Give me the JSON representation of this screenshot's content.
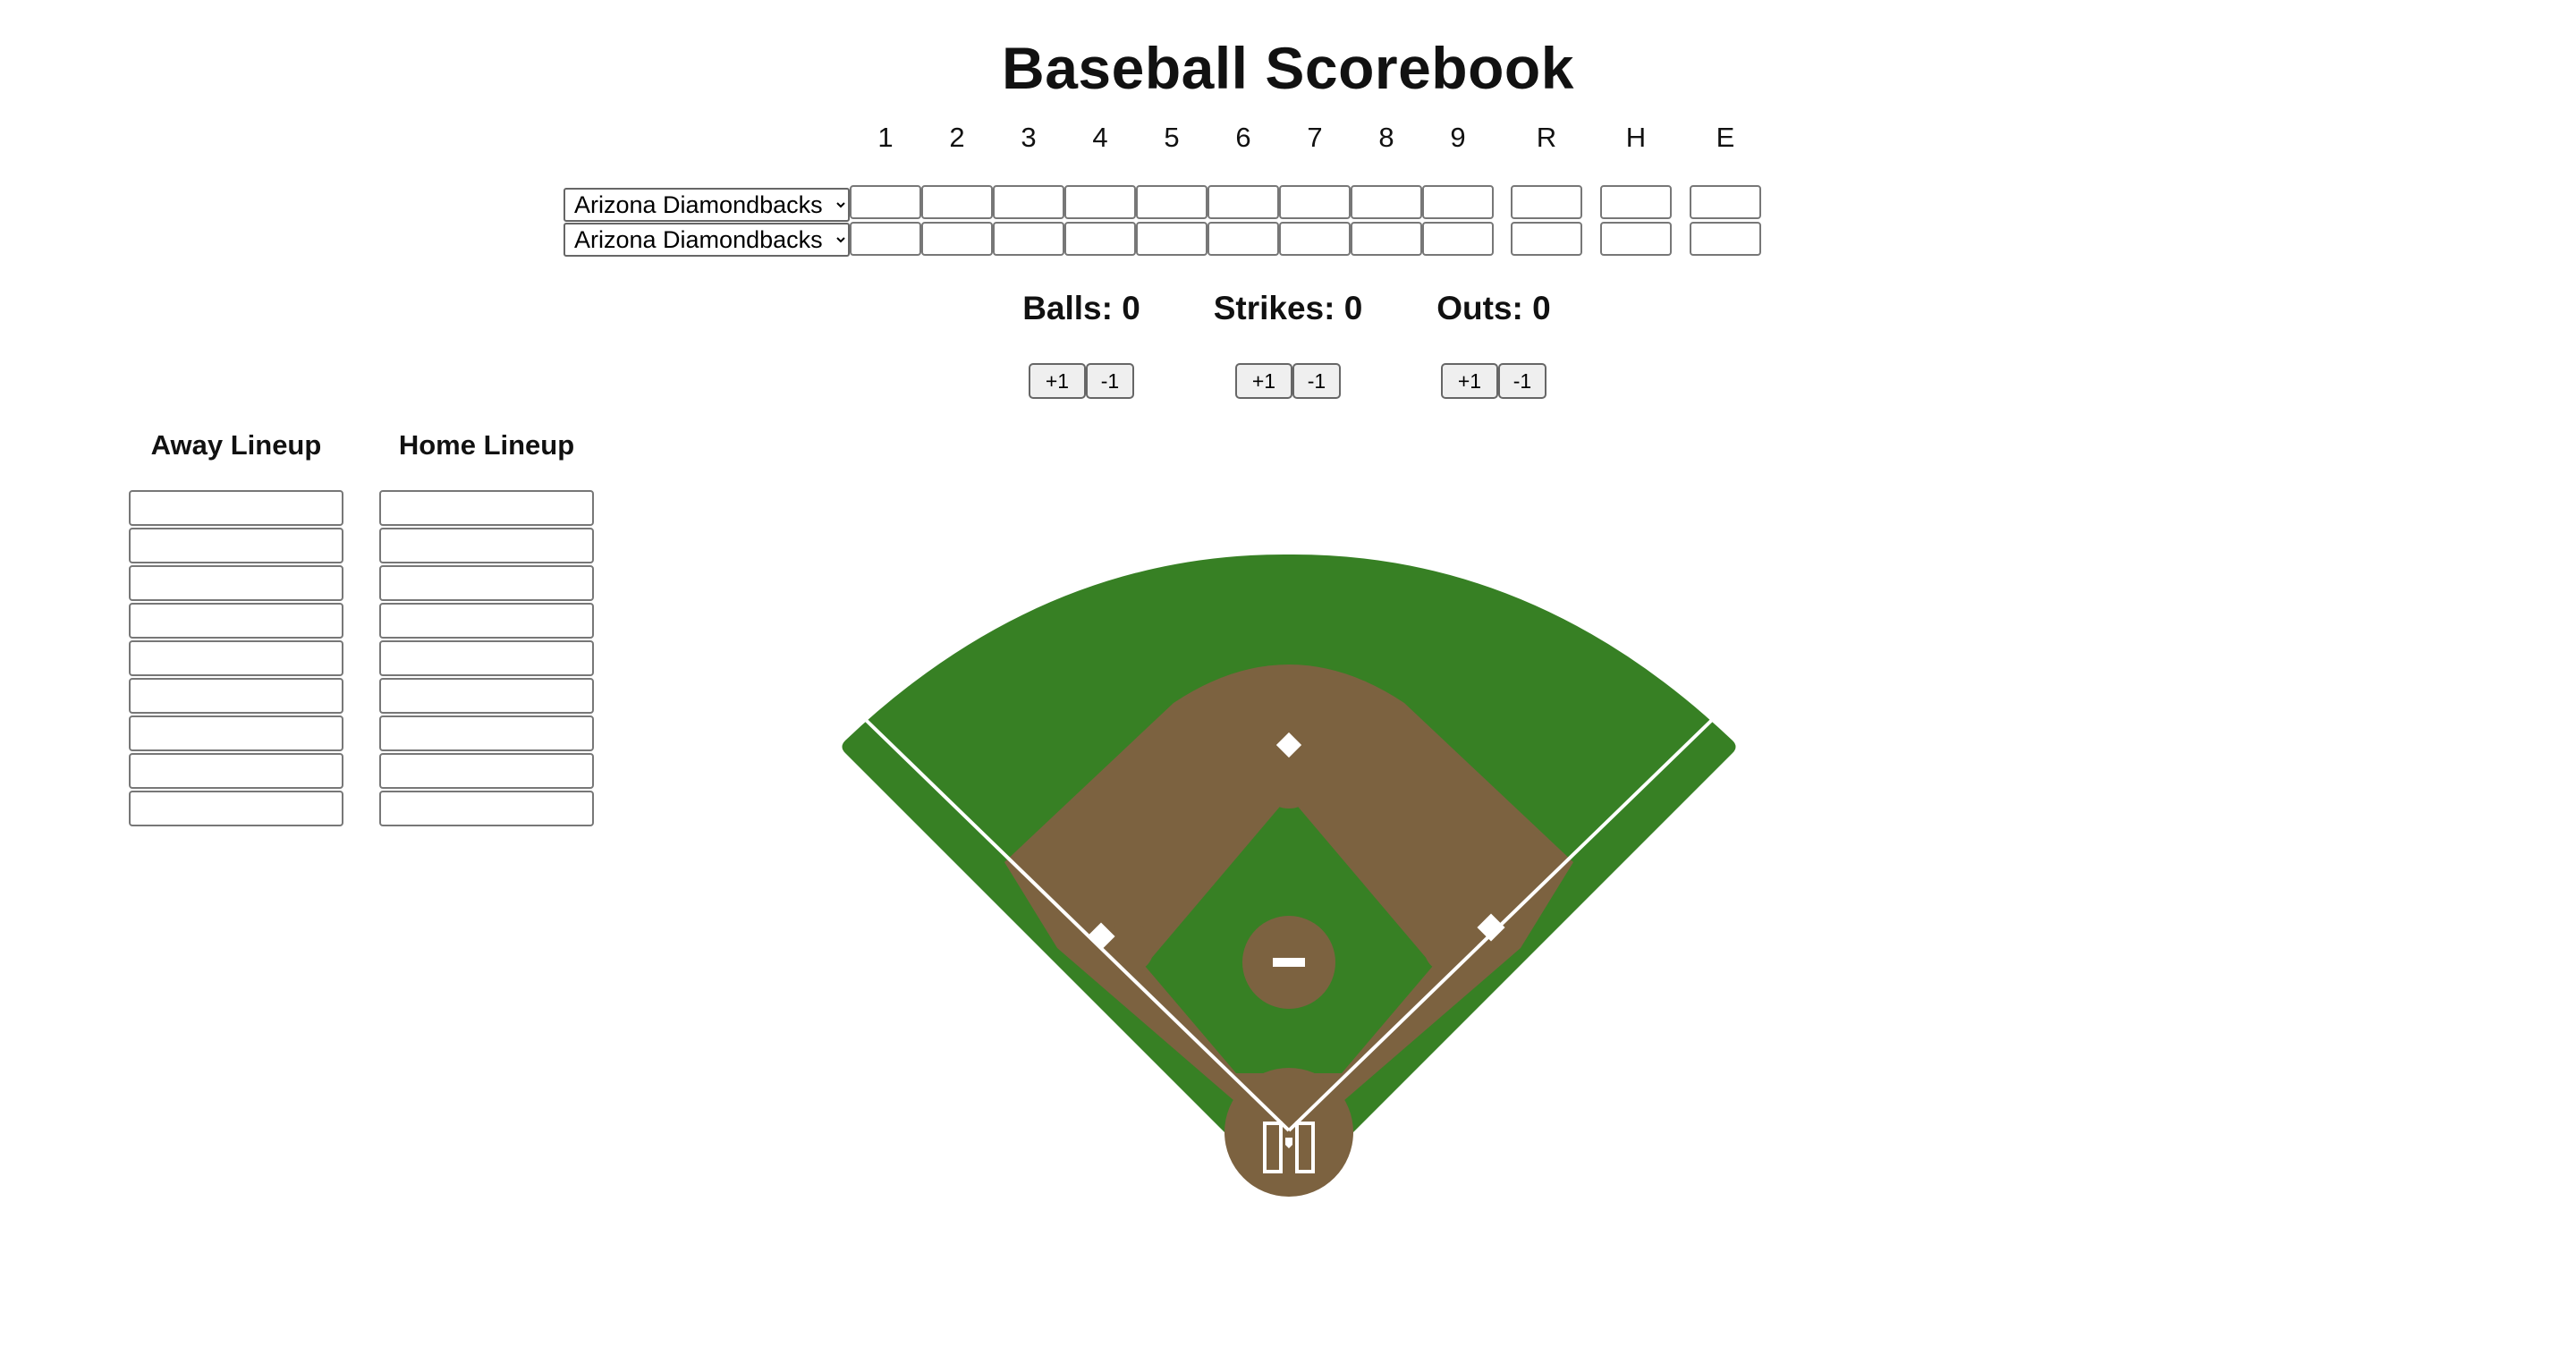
{
  "page": {
    "title": "Baseball Scorebook"
  },
  "scoreboard": {
    "innings": [
      "1",
      "2",
      "3",
      "4",
      "5",
      "6",
      "7",
      "8",
      "9"
    ],
    "totals": [
      "R",
      "H",
      "E"
    ],
    "teams": [
      {
        "role": "away",
        "selected": "Arizona Diamondbacks",
        "innings": [
          "",
          "",
          "",
          "",
          "",
          "",
          "",
          "",
          ""
        ],
        "totals": [
          "",
          "",
          ""
        ]
      },
      {
        "role": "home",
        "selected": "Arizona Diamondbacks",
        "innings": [
          "",
          "",
          "",
          "",
          "",
          "",
          "",
          "",
          ""
        ],
        "totals": [
          "",
          "",
          ""
        ]
      }
    ]
  },
  "counters": [
    {
      "label": "Balls: 0",
      "plus": "+1",
      "minus": "-1"
    },
    {
      "label": "Strikes: 0",
      "plus": "+1",
      "minus": "-1"
    },
    {
      "label": "Outs: 0",
      "plus": "+1",
      "minus": "-1"
    }
  ],
  "lineups": {
    "away": {
      "title": "Away Lineup",
      "players": [
        "",
        "",
        "",
        "",
        "",
        "",
        "",
        "",
        ""
      ]
    },
    "home": {
      "title": "Home Lineup",
      "players": [
        "",
        "",
        "",
        "",
        "",
        "",
        "",
        "",
        ""
      ]
    }
  },
  "colors": {
    "grass": "#378024",
    "dirt": "#7c6240",
    "lines": "#ffffff"
  }
}
